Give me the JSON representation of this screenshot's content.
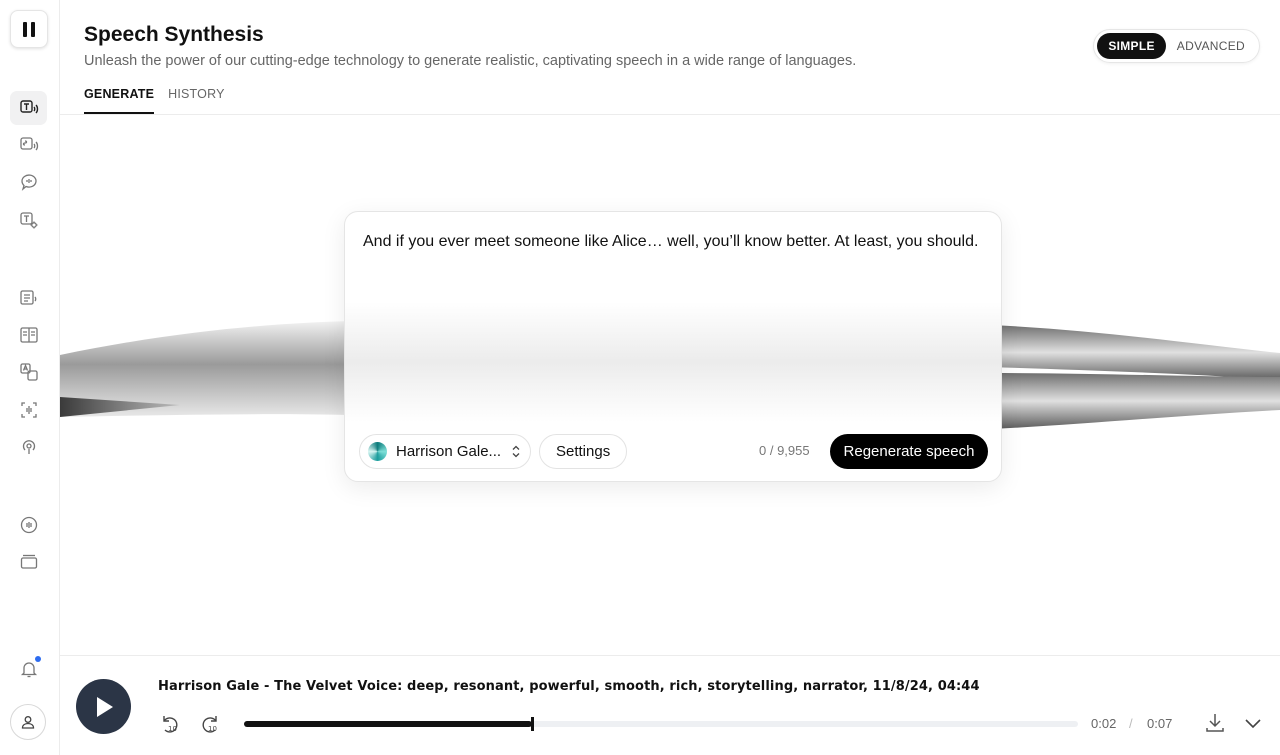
{
  "header": {
    "title": "Speech Synthesis",
    "subtitle": "Unleash the power of our cutting-edge technology to generate realistic, captivating speech in a wide range of languages.",
    "tabs": [
      {
        "label": "GENERATE",
        "active": true
      },
      {
        "label": "HISTORY",
        "active": false
      }
    ],
    "mode": {
      "simple_label": "SIMPLE",
      "advanced_label": "ADVANCED",
      "selected": "SIMPLE"
    }
  },
  "sidebar": {
    "items": [
      {
        "icon": "text-to-speech-icon",
        "active": true
      },
      {
        "icon": "speech-to-speech-icon",
        "active": false
      },
      {
        "icon": "voice-chat-icon",
        "active": false
      },
      {
        "icon": "voice-settings-icon",
        "active": false
      },
      {
        "icon": "projects-icon",
        "active": false
      },
      {
        "icon": "layout-icon",
        "active": false
      },
      {
        "icon": "translate-icon",
        "active": false
      },
      {
        "icon": "voice-isolator-icon",
        "active": false
      },
      {
        "icon": "podcast-icon",
        "active": false
      },
      {
        "icon": "voice-library-icon",
        "active": false
      },
      {
        "icon": "library-icon",
        "active": false
      }
    ],
    "notifications_badge": true
  },
  "editor": {
    "text": "And if you ever meet someone like Alice… well, you’ll know better. At least, you should.",
    "voice_name": "Harrison Gale...",
    "settings_label": "Settings",
    "char_count": "0 / 9,955",
    "submit_label": "Regenerate speech"
  },
  "player": {
    "track_title": "Harrison Gale - The Velvet Voice: deep, resonant, powerful, smooth, rich, storytelling, narrator, 11/8/24, 04:44",
    "current_time": "0:02",
    "separator": "/",
    "total_time": "0:07",
    "progress": 0.345
  },
  "colors": {
    "accent": "#111111",
    "play_button": "#2b3546",
    "notification": "#2d6cf0"
  }
}
